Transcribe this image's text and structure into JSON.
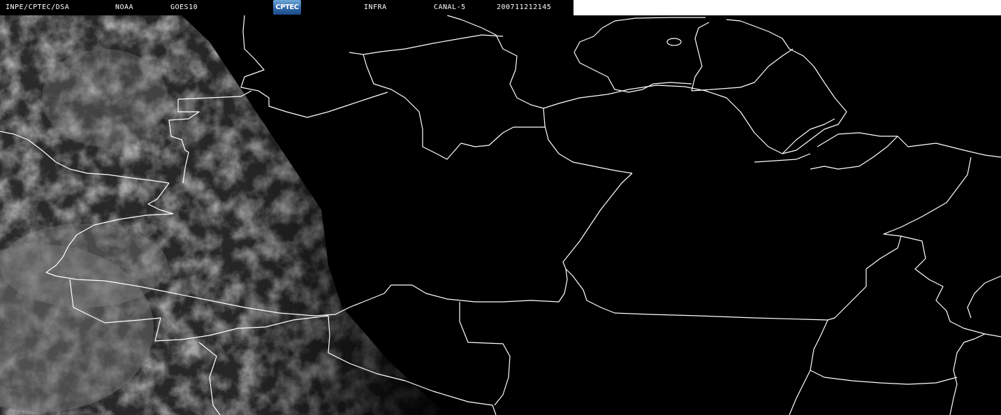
{
  "header": {
    "institution": "INPE/CPTEC/DSA",
    "agency": "NOAA",
    "satellite": "GOES10",
    "logo_text": "CPTEC",
    "product": "INFRA",
    "channel": "CANAL-5",
    "timestamp": "200711212145"
  },
  "colors": {
    "background": "#000000",
    "borders": "#ffffff",
    "clouds": "#9a9a9a",
    "header_text": "#ffffff"
  },
  "map": {
    "type": "satellite-infrared-image",
    "layers": [
      "political-borders",
      "cloud-cover"
    ]
  }
}
